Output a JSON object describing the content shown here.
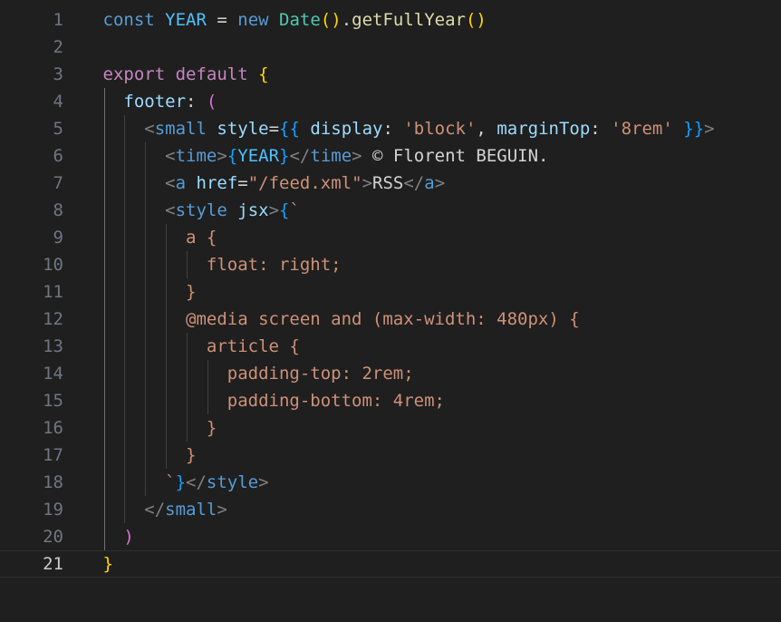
{
  "editor": {
    "line_numbers": [
      "1",
      "2",
      "3",
      "4",
      "5",
      "6",
      "7",
      "8",
      "9",
      "10",
      "11",
      "12",
      "13",
      "14",
      "15",
      "16",
      "17",
      "18",
      "19",
      "20",
      "21"
    ],
    "lines": [
      [
        {
          "t": "const",
          "c": "kw"
        },
        {
          "t": " ",
          "c": "text"
        },
        {
          "t": "YEAR",
          "c": "var"
        },
        {
          "t": " = ",
          "c": "text"
        },
        {
          "t": "new",
          "c": "kw"
        },
        {
          "t": " ",
          "c": "text"
        },
        {
          "t": "Date",
          "c": "type"
        },
        {
          "t": "()",
          "c": "b1"
        },
        {
          "t": ".",
          "c": "text"
        },
        {
          "t": "getFullYear",
          "c": "fn"
        },
        {
          "t": "()",
          "c": "b1"
        }
      ],
      [],
      [
        {
          "t": "export",
          "c": "ctrl"
        },
        {
          "t": " ",
          "c": "text"
        },
        {
          "t": "default",
          "c": "ctrl"
        },
        {
          "t": " ",
          "c": "text"
        },
        {
          "t": "{",
          "c": "b1"
        }
      ],
      [
        {
          "t": "  ",
          "c": "text"
        },
        {
          "t": "footer",
          "c": "key"
        },
        {
          "t": ": ",
          "c": "text"
        },
        {
          "t": "(",
          "c": "b2"
        }
      ],
      [
        {
          "t": "    ",
          "c": "text"
        },
        {
          "t": "<",
          "c": "punc"
        },
        {
          "t": "small",
          "c": "tag"
        },
        {
          "t": " ",
          "c": "text"
        },
        {
          "t": "style",
          "c": "key"
        },
        {
          "t": "=",
          "c": "text"
        },
        {
          "t": "{{",
          "c": "b3"
        },
        {
          "t": " ",
          "c": "text"
        },
        {
          "t": "display",
          "c": "key"
        },
        {
          "t": ": ",
          "c": "text"
        },
        {
          "t": "'block'",
          "c": "str"
        },
        {
          "t": ", ",
          "c": "text"
        },
        {
          "t": "marginTop",
          "c": "key"
        },
        {
          "t": ": ",
          "c": "text"
        },
        {
          "t": "'8rem'",
          "c": "str"
        },
        {
          "t": " ",
          "c": "text"
        },
        {
          "t": "}}",
          "c": "b3"
        },
        {
          "t": ">",
          "c": "punc"
        }
      ],
      [
        {
          "t": "      ",
          "c": "text"
        },
        {
          "t": "<",
          "c": "punc"
        },
        {
          "t": "time",
          "c": "tag"
        },
        {
          "t": ">",
          "c": "punc"
        },
        {
          "t": "{",
          "c": "b3"
        },
        {
          "t": "YEAR",
          "c": "var"
        },
        {
          "t": "}",
          "c": "b3"
        },
        {
          "t": "</",
          "c": "punc"
        },
        {
          "t": "time",
          "c": "tag"
        },
        {
          "t": ">",
          "c": "punc"
        },
        {
          "t": " © Florent BEGUIN.",
          "c": "text"
        }
      ],
      [
        {
          "t": "      ",
          "c": "text"
        },
        {
          "t": "<",
          "c": "punc"
        },
        {
          "t": "a",
          "c": "tag"
        },
        {
          "t": " ",
          "c": "text"
        },
        {
          "t": "href",
          "c": "key"
        },
        {
          "t": "=",
          "c": "text"
        },
        {
          "t": "\"/feed.xml\"",
          "c": "str"
        },
        {
          "t": ">",
          "c": "punc"
        },
        {
          "t": "RSS",
          "c": "text"
        },
        {
          "t": "</",
          "c": "punc"
        },
        {
          "t": "a",
          "c": "tag"
        },
        {
          "t": ">",
          "c": "punc"
        }
      ],
      [
        {
          "t": "      ",
          "c": "text"
        },
        {
          "t": "<",
          "c": "punc"
        },
        {
          "t": "style",
          "c": "tag"
        },
        {
          "t": " ",
          "c": "text"
        },
        {
          "t": "jsx",
          "c": "key"
        },
        {
          "t": ">",
          "c": "punc"
        },
        {
          "t": "{",
          "c": "b3"
        },
        {
          "t": "`",
          "c": "str"
        }
      ],
      [
        {
          "t": "        a {",
          "c": "str"
        }
      ],
      [
        {
          "t": "          float: right;",
          "c": "str"
        }
      ],
      [
        {
          "t": "        }",
          "c": "str"
        }
      ],
      [
        {
          "t": "        @media screen and (max-width: 480px) {",
          "c": "str"
        }
      ],
      [
        {
          "t": "          article {",
          "c": "str"
        }
      ],
      [
        {
          "t": "            padding-top: 2rem;",
          "c": "str"
        }
      ],
      [
        {
          "t": "            padding-bottom: 4rem;",
          "c": "str"
        }
      ],
      [
        {
          "t": "          }",
          "c": "str"
        }
      ],
      [
        {
          "t": "        }",
          "c": "str"
        }
      ],
      [
        {
          "t": "      `",
          "c": "str"
        },
        {
          "t": "}",
          "c": "b3"
        },
        {
          "t": "</",
          "c": "punc"
        },
        {
          "t": "style",
          "c": "tag"
        },
        {
          "t": ">",
          "c": "punc"
        }
      ],
      [
        {
          "t": "    ",
          "c": "text"
        },
        {
          "t": "</",
          "c": "punc"
        },
        {
          "t": "small",
          "c": "tag"
        },
        {
          "t": ">",
          "c": "punc"
        }
      ],
      [
        {
          "t": "  ",
          "c": "text"
        },
        {
          "t": ")",
          "c": "b2"
        }
      ],
      [
        {
          "t": "}",
          "c": "b1"
        }
      ]
    ],
    "current_line": 21
  },
  "colors": {
    "background": "#1f1f1f",
    "keyword": "#569cd6",
    "control": "#c586c0",
    "variable": "#4fc1ff",
    "type": "#4ec9b0",
    "function": "#dcdcaa",
    "string": "#ce9178",
    "property": "#9cdcfe",
    "bracket_1": "#ffd700",
    "bracket_2": "#da70d6",
    "bracket_3": "#179fff"
  }
}
